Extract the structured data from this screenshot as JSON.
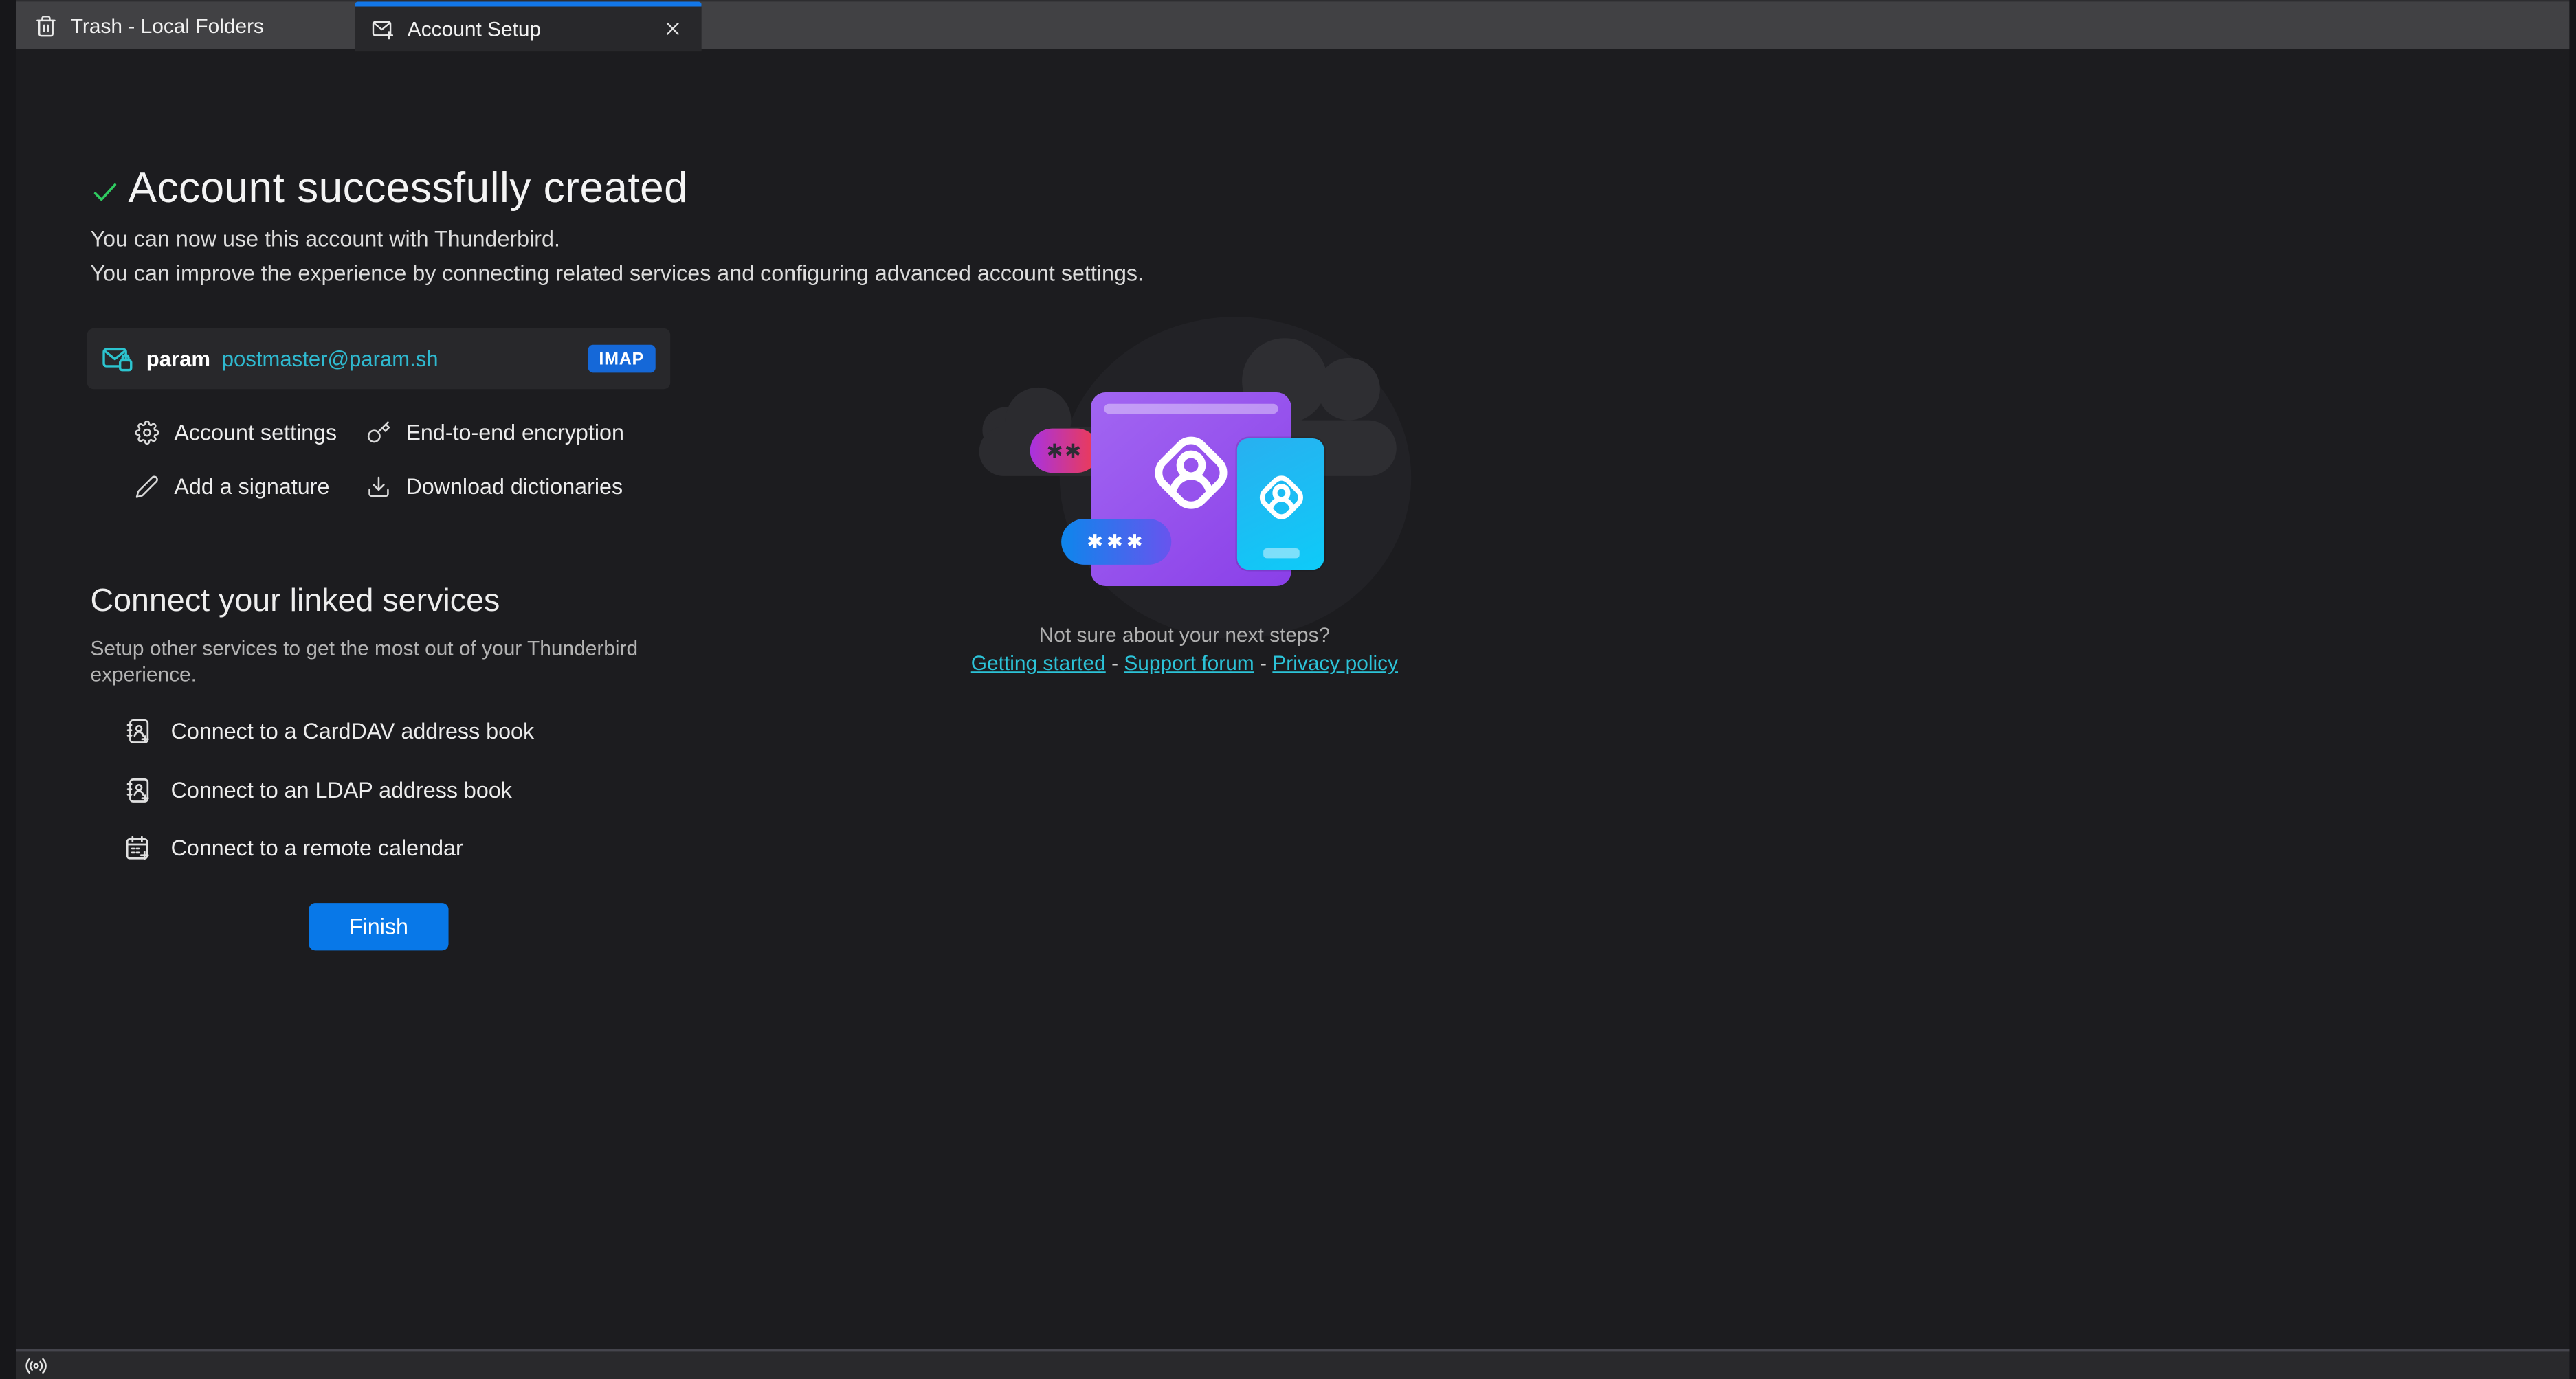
{
  "window": {
    "tabs": [
      {
        "label": "Trash - Local Folders",
        "icon": "trash-icon",
        "active": false
      },
      {
        "label": "Account Setup",
        "icon": "mail-plus-icon",
        "active": true
      }
    ]
  },
  "header": {
    "title": "Account successfully created",
    "subtitle_line1": "You can now use this account with Thunderbird.",
    "subtitle_line2": "You can improve the experience by connecting related services and configuring advanced account settings."
  },
  "account_card": {
    "name": "param",
    "email": "postmaster@param.sh",
    "protocol_badge": "IMAP"
  },
  "quick_links": [
    {
      "label": "Account settings",
      "icon": "gear-icon"
    },
    {
      "label": "End-to-end encryption",
      "icon": "key-icon"
    },
    {
      "label": "Add a signature",
      "icon": "pencil-icon"
    },
    {
      "label": "Download dictionaries",
      "icon": "download-icon"
    }
  ],
  "linked_services": {
    "heading": "Connect your linked services",
    "description": "Setup other services to get the most out of your Thunderbird experience.",
    "links": [
      {
        "label": "Connect to a CardDAV address book",
        "icon": "address-book-icon"
      },
      {
        "label": "Connect to an LDAP address book",
        "icon": "address-book-icon"
      },
      {
        "label": "Connect to a remote calendar",
        "icon": "calendar-icon"
      }
    ],
    "finish_button": "Finish"
  },
  "help": {
    "question": "Not sure about your next steps?",
    "links": [
      "Getting started",
      "Support forum",
      "Privacy policy"
    ],
    "separator": "-"
  },
  "illustration": {
    "password_pill_small": "✱✱",
    "password_pill_large": "✱✱✱"
  },
  "colors": {
    "accent_blue": "#1377e8",
    "button_blue": "#0878e8",
    "badge_blue": "#1568d8",
    "link_cyan": "#2cc3d8",
    "email_teal": "#2fb9cf",
    "success_green": "#2fca60",
    "tabbar_grey": "#414144",
    "content_bg": "#1c1c1f",
    "card_bg": "#28282b"
  }
}
